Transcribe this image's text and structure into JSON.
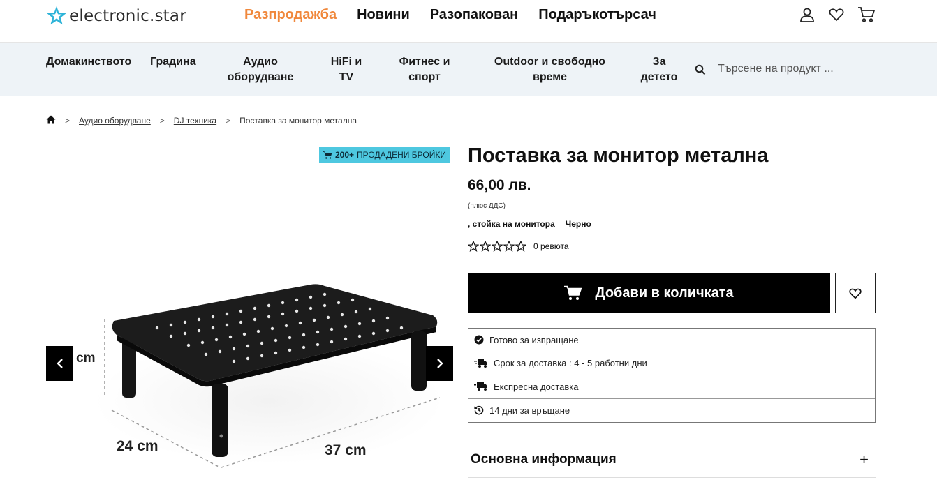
{
  "header": {
    "logo_text": "electronic.star",
    "nav": [
      {
        "label": "Разпродажба",
        "accent": "#f0883c"
      },
      {
        "label": "Новини"
      },
      {
        "label": "Разопакован"
      },
      {
        "label": "Подаръкотърсач"
      }
    ],
    "icons": [
      "user-icon",
      "heart-icon",
      "cart-icon"
    ]
  },
  "categories": [
    {
      "label": "Домакинството"
    },
    {
      "label": "Градина"
    },
    {
      "label": "Аудио оборудване"
    },
    {
      "label": "HiFi и TV"
    },
    {
      "label": "Фитнес и спорт"
    },
    {
      "label": "Outdoor и свободно време"
    },
    {
      "label": "За детето"
    }
  ],
  "search": {
    "placeholder": "Търсене на продукт ..."
  },
  "breadcrumb": {
    "items": [
      "Аудио оборудване",
      "DJ техника",
      "Поставка за монитор метална"
    ]
  },
  "gallery": {
    "badge_count": "200+",
    "badge_text": "ПРОДАДЕНИ БРОЙКИ",
    "dim_height": "cm",
    "dim_depth": "24 cm",
    "dim_width": "37 cm"
  },
  "product": {
    "title": "Поставка за монитор метална",
    "price": "66,00 лв.",
    "vat_note": "(плюс ДДС)",
    "attr_type": ", стойка на монитора",
    "attr_color": "Черно",
    "rating_stars": 0,
    "reviews": "0 ревюта",
    "add_to_cart": "Добави в количката"
  },
  "info": [
    {
      "icon": "check-circle-icon",
      "text": "Готово за изпращане"
    },
    {
      "icon": "delivery-truck-icon",
      "text": "Срок за доставка : 4 - 5 работни дни"
    },
    {
      "icon": "express-truck-icon",
      "text": "Експресна доставка"
    },
    {
      "icon": "return-clock-icon",
      "text": "14 дни за връщане"
    }
  ],
  "accordion": {
    "label": "Основна информация"
  },
  "colors": {
    "accent": "#f0883c",
    "badge": "#4ec8e0",
    "catbar": "#eef3f7"
  }
}
